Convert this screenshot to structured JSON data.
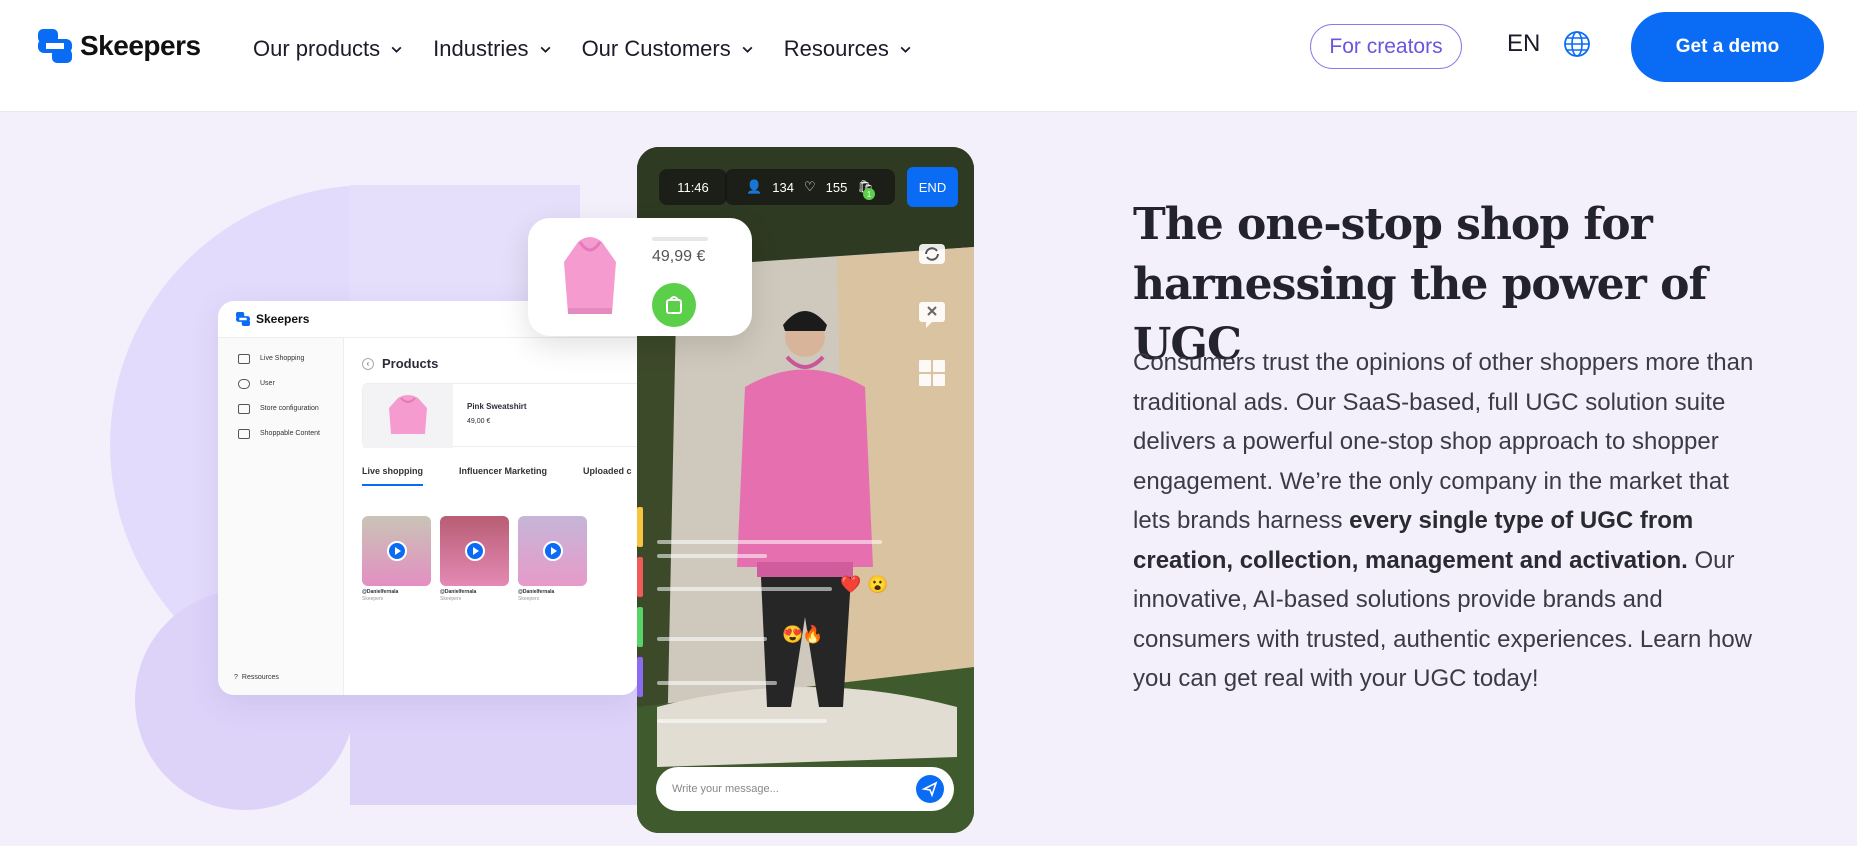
{
  "header": {
    "brand": "Skeepers",
    "nav": [
      "Our products",
      "Industries",
      "Our Customers",
      "Resources"
    ],
    "for_creators": "For creators",
    "language": "EN",
    "demo_label": "Get a demo"
  },
  "dashboard": {
    "brand": "Skeepers",
    "sidebar": [
      "Live Shopping",
      "User",
      "Store configuration",
      "Shoppable Content"
    ],
    "resources": "Ressources",
    "title": "Products",
    "product_name": "Pink Sweatshirt",
    "product_price": "49,00 €",
    "tabs": [
      "Live shopping",
      "Influencer Marketing",
      "Uploaded c"
    ],
    "thumbs": [
      {
        "user": "@Danielfernala",
        "sub": "Skeepers"
      },
      {
        "user": "@Danielfernala",
        "sub": "Skeepers"
      },
      {
        "user": "@Danielfernala",
        "sub": "Skeepers"
      }
    ]
  },
  "phone": {
    "time": "11:46",
    "viewers": "134",
    "likes": "155",
    "cart_count": "1",
    "end_label": "END",
    "message_placeholder": "Write your message..."
  },
  "popup": {
    "price": "49,99 €"
  },
  "hero": {
    "heading": "The one-stop shop for harnessing the power of UGC",
    "para_part1": "Consumers trust the opinions of other shoppers more than traditional ads. Our SaaS-based, full UGC solution suite delivers a powerful one-stop shop approach to shopper engagement. We’re the only company in the market that lets brands harness ",
    "para_bold": "every single type of UGC from creation, collection, management and activation.",
    "para_part2": " Our innovative, AI-based solutions provide brands and consumers with trusted, authentic experiences. Learn how you can get real with your UGC today!"
  },
  "colors": {
    "accent": "#0a6cf5",
    "creators_purple": "#6b55e0",
    "hero_bg": "#f3f0fc",
    "cart_green": "#5ccf4a"
  }
}
